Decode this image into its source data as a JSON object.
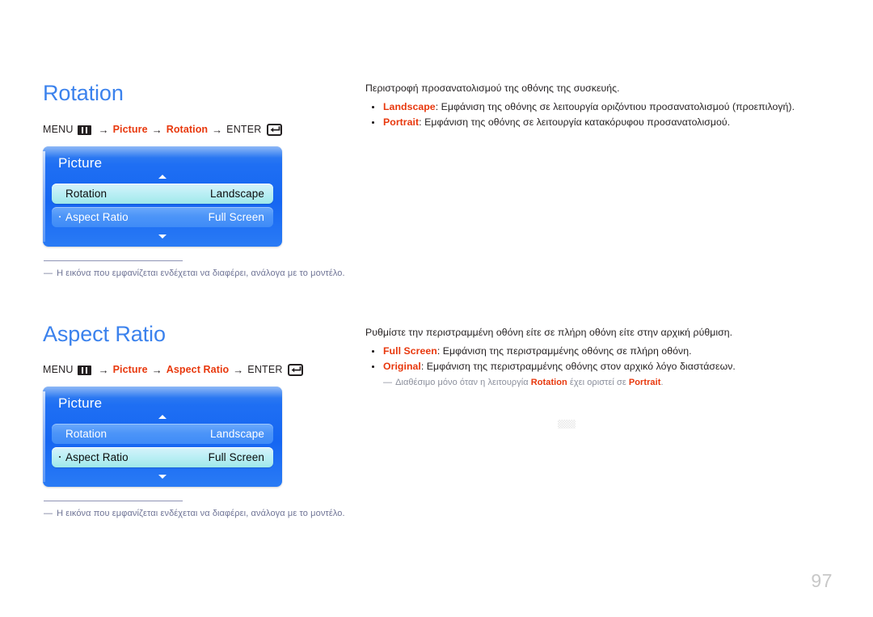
{
  "page": {
    "number": "97",
    "heading_color": "#3b82ed",
    "term_color": "#e8380d",
    "footnote_color": "#6f7496"
  },
  "sections": [
    {
      "id": "rotation",
      "heading": "Rotation",
      "menu_path": {
        "menu_label": "MENU",
        "menu_icon": "menu-icon",
        "arrow": "→",
        "step1": "Picture",
        "step2": "Rotation",
        "enter_label": "ENTER",
        "enter_icon": "enter-icon"
      },
      "osd": {
        "title": "Picture",
        "scroll_up": "▲",
        "scroll_down": "▼",
        "rows": [
          {
            "label": "Rotation",
            "value": "Landscape",
            "state": "selected",
            "has_dot": false
          },
          {
            "label": "Aspect Ratio",
            "value": "Full Screen",
            "state": "unselected",
            "has_dot": true
          }
        ]
      },
      "footnote": {
        "dash": "―",
        "text": "Η εικόνα που εμφανίζεται ενδέχεται να διαφέρει, ανάλογα με το μοντέλο."
      },
      "description": {
        "intro": "Περιστροφή προσανατολισμού της οθόνης της συσκευής.",
        "bullets": [
          {
            "term": "Landscape",
            "text": ": Εμφάνιση της οθόνης σε λειτουργία οριζόντιου προσανατολισμού (προεπιλογή)."
          },
          {
            "term": "Portrait",
            "text": ": Εμφάνιση της οθόνης σε λειτουργία κατακόρυφου προσανατολισμού."
          }
        ]
      }
    },
    {
      "id": "aspect",
      "heading": "Aspect Ratio",
      "menu_path": {
        "menu_label": "MENU",
        "menu_icon": "menu-icon",
        "arrow": "→",
        "step1": "Picture",
        "step2": "Aspect Ratio",
        "enter_label": "ENTER",
        "enter_icon": "enter-icon"
      },
      "osd": {
        "title": "Picture",
        "scroll_up": "▲",
        "scroll_down": "▼",
        "rows": [
          {
            "label": "Rotation",
            "value": "Landscape",
            "state": "unselected",
            "has_dot": false
          },
          {
            "label": "Aspect Ratio",
            "value": "Full Screen",
            "state": "selected",
            "has_dot": true
          }
        ]
      },
      "footnote": {
        "dash": "―",
        "text": "Η εικόνα που εμφανίζεται ενδέχεται να διαφέρει, ανάλογα με το μοντέλο."
      },
      "description": {
        "intro": "Ρυθμίστε την περιστραμμένη οθόνη είτε σε πλήρη οθόνη είτε στην αρχική ρύθμιση.",
        "bullets": [
          {
            "term": "Full Screen",
            "text": ": Εμφάνιση της περιστραμμένης οθόνης σε πλήρη οθόνη."
          },
          {
            "term": "Original",
            "text": ": Εμφάνιση της περιστραμμένης οθόνης στον αρχικό λόγο διαστάσεων."
          }
        ],
        "subnote": {
          "dash": "―",
          "before": "Διαθέσιμο μόνο όταν η λειτουργία ",
          "term1": "Rotation",
          "middle": " έχει οριστεί σε ",
          "term2": "Portrait",
          "after": "."
        }
      }
    }
  ]
}
